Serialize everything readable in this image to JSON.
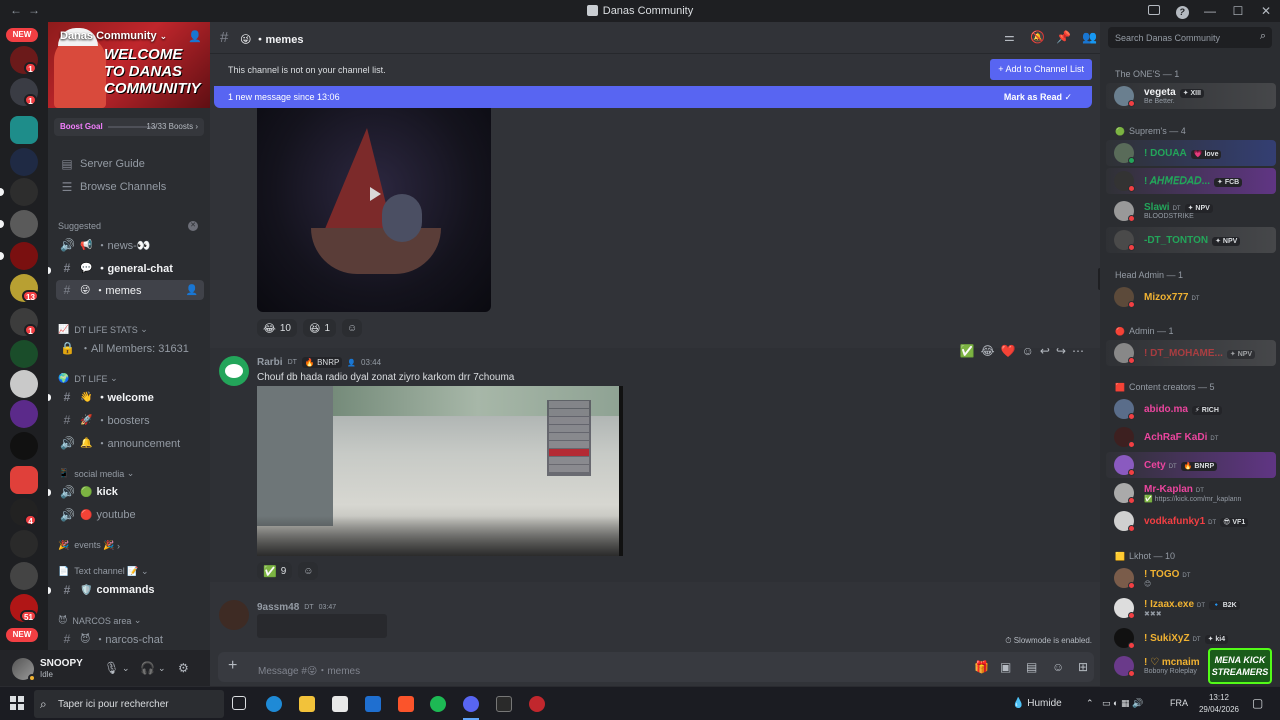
{
  "window": {
    "title": "Danas Community",
    "nav_back": "←",
    "nav_forward": "→",
    "minimize": "—",
    "maximize": "☐",
    "close": "✕",
    "help": "?"
  },
  "rail": {
    "new_badge": "NEW",
    "badges": [
      "1",
      "1",
      "13",
      "1",
      "4",
      "51"
    ],
    "new_badge_bottom": "NEW"
  },
  "server": {
    "name": "Danas Community",
    "banner_text_1": "WELCOME",
    "banner_text_2": "TO DANAS",
    "banner_text_3": "COMMUNITIY",
    "boost_goal_label": "Boost Goal",
    "boost_count": "13/33 Boosts",
    "boost_chevron": "›"
  },
  "sidebar": {
    "server_guide": "Server Guide",
    "browse_channels": "Browse Channels",
    "suggested": "Suggested",
    "channels_suggested": [
      {
        "emoji": "📢",
        "name": "・news-👀",
        "icon": "🔊"
      },
      {
        "emoji": "💬",
        "name": "・general-chat",
        "icon": "#"
      },
      {
        "emoji": "😜",
        "name": "・memes",
        "icon": "#"
      }
    ],
    "cat_stats": "DT LIFE STATS",
    "cat_stats_emoji": "📈",
    "all_members": "・All Members: 31631",
    "cat_dtlife": "DT LIFE",
    "cat_dtlife_emoji": "🌍",
    "dtlife_channels": [
      {
        "emoji": "👋",
        "name": "・welcome",
        "icon": "#"
      },
      {
        "emoji": "🚀",
        "name": "・boosters",
        "icon": "#"
      },
      {
        "emoji": "🔔",
        "name": "・announcement",
        "icon": "🔊"
      }
    ],
    "cat_social": "social media",
    "cat_social_emoji": "📱",
    "social_channels": [
      {
        "emoji": "🟢",
        "name": "kick",
        "icon": "🔊"
      },
      {
        "emoji": "🔴",
        "name": "youtube",
        "icon": "🔊"
      }
    ],
    "cat_events": "events 🎉",
    "cat_events_emoji": "🎉",
    "cat_text": "Text channel 📝",
    "cat_text_emoji": "📄",
    "text_channels": [
      {
        "emoji": "🛡️",
        "name": "commands",
        "icon": "#"
      }
    ],
    "cat_narcos": "NARCOS area",
    "cat_narcos_emoji": "😈",
    "narcos_channels": [
      {
        "emoji": "😈",
        "name": "・narcos-chat",
        "icon": "#"
      }
    ]
  },
  "user_panel": {
    "name": "SNOOPY",
    "status": "Idle",
    "status_color": "#f0b232",
    "mic_icon": "🎙",
    "headset_icon": "🎧",
    "settings_icon": "⚙"
  },
  "channel": {
    "hash": "#",
    "emoji": "😜",
    "name": "・memes",
    "notice": "This channel is not on your channel list.",
    "add_button": "+ Add to Channel List",
    "new_messages": "1 new message since 13:06",
    "mark_read": "Mark as Read"
  },
  "messages": [
    {
      "reactions": [
        {
          "emoji": "😂",
          "count": "10"
        },
        {
          "emoji": "😆",
          "count": "1"
        }
      ]
    },
    {
      "author": "Rarbi",
      "tag": "DT",
      "guild_tag": "BNRP",
      "time": "03:44",
      "text": "Chouf db hada radio dyal zonat ziyro karkom drr 7chouma",
      "toolbar": [
        "✅",
        "😂",
        "❤️"
      ],
      "reactions": [
        {
          "emoji": "✅",
          "count": "9"
        }
      ]
    },
    {
      "author": "9assm48",
      "tag": "DT",
      "time": "03:47"
    }
  ],
  "slowmode": "Slowmode is enabled.",
  "composer": {
    "placeholder": "Message #😜・memes"
  },
  "members": {
    "search_placeholder": "Search Danas Community",
    "groups": [
      {
        "label": "The ONE'S — 1",
        "members": [
          {
            "name": "vegeta",
            "sub": "Be Better.",
            "gtag": "XIII",
            "color": "#f2f3f5",
            "status": "#f23f43",
            "style": "grey"
          }
        ]
      },
      {
        "label": "Suprem's — 4",
        "members": [
          {
            "name": "! DOUAA",
            "gtag": "love",
            "sub": "",
            "color": "#23a55a",
            "status": "#23a55a",
            "style": "green"
          },
          {
            "name": "! 𝘈𝘏𝘔𝘌𝘋𝘈𝘋...",
            "gtag": "FCB",
            "sub": "",
            "color": "#23a55a",
            "status": "#f23f43",
            "style": "purple"
          },
          {
            "name": "Slawi",
            "tag": "DT",
            "gtag": "NPV",
            "sub": "BLOODSTRIKE",
            "color": "#23a55a",
            "status": "#f23f43",
            "style": ""
          },
          {
            "name": "-DT_TONTON",
            "gtag": "NPV",
            "sub": "",
            "color": "#23a55a",
            "status": "#f23f43",
            "style": "grey"
          }
        ]
      },
      {
        "label": "Head Admin — 1",
        "members": [
          {
            "name": "Mizox777",
            "tag": "DT",
            "sub": "",
            "color": "#f0b232",
            "status": "#f23f43",
            "style": ""
          }
        ]
      },
      {
        "label": "Admin — 1",
        "members": [
          {
            "name": "! DT_MOHAME...",
            "gtag": "NPV",
            "sub": "",
            "color": "#f23f43",
            "status": "#f23f43",
            "style": "grey"
          }
        ]
      },
      {
        "label": "Content creators — 5",
        "members": [
          {
            "name": "abido.ma",
            "gtag": "RICH",
            "sub": "",
            "color": "#eb459e",
            "status": "#f23f43",
            "style": ""
          },
          {
            "name": "AchRaF KaDi",
            "tag": "DT",
            "sub": "",
            "color": "#eb459e",
            "status": "#f23f43",
            "style": ""
          },
          {
            "name": "Cety",
            "tag": "DT",
            "gtag": "BNRP",
            "sub": "",
            "color": "#eb459e",
            "status": "#f23f43",
            "style": "purple"
          },
          {
            "name": "Mr-Kaplan",
            "tag": "DT",
            "sub": "https://kick.com/mr_kaplann",
            "color": "#eb459e",
            "status": "#f23f43",
            "style": ""
          },
          {
            "name": "vodkafunky1",
            "tag": "DT",
            "gtag": "VF1",
            "sub": "",
            "color": "#f23f43",
            "status": "#f23f43",
            "style": ""
          }
        ]
      },
      {
        "label": "Lkhot — 10",
        "members": [
          {
            "name": "! TOGO",
            "tag": "DT",
            "sub": "",
            "color": "#f0b232",
            "status": "#f23f43",
            "style": ""
          },
          {
            "name": "! Izaax.exe",
            "tag": "DT",
            "gtag": "B2K",
            "sub": "",
            "color": "#f0b232",
            "status": "#f23f43",
            "style": ""
          },
          {
            "name": "! SukiXyZ",
            "tag": "DT",
            "gtag": "ki4",
            "sub": "",
            "color": "#f0b232",
            "status": "#f23f43",
            "style": ""
          },
          {
            "name": "! ♡ mcnaim",
            "sub": "Bobony Roleplay",
            "color": "#f0b232",
            "status": "#f23f43",
            "style": ""
          }
        ]
      }
    ]
  },
  "overlay_badge": {
    "line1": "MENA KICK",
    "line2": "STREAMERS"
  },
  "taskbar": {
    "search_placeholder": "Taper ici pour rechercher",
    "weather": "Humide",
    "language": "FRA",
    "time": "13:12",
    "date": "29/04/2026"
  }
}
